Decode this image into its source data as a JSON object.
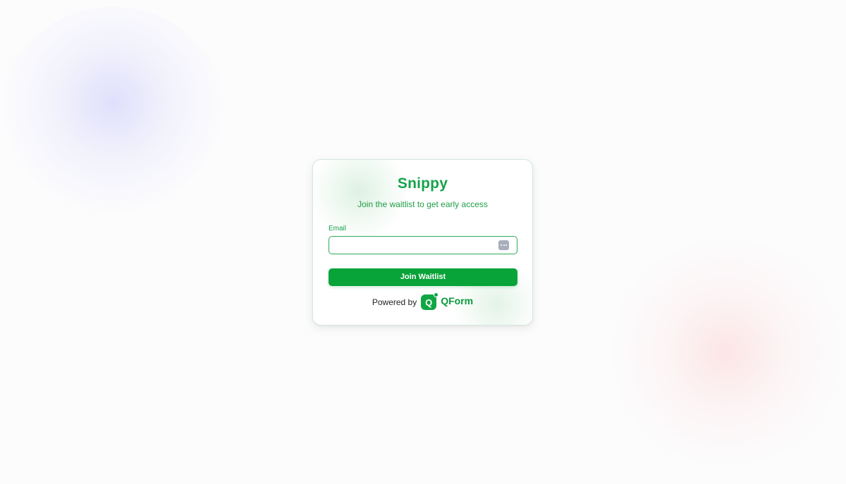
{
  "form": {
    "title": "Snippy",
    "subtitle": "Join the waitlist to get early access",
    "email_label": "Email",
    "email_value": "",
    "email_placeholder": "",
    "submit_label": "Join Waitlist"
  },
  "footer": {
    "powered_by": "Powered by",
    "logo_letter": "Q",
    "brand_name": "QForm"
  },
  "icons": {
    "password_manager": "password-manager-icon",
    "brand_logo": "qform-logo-icon"
  },
  "colors": {
    "accent": "#16a34a",
    "button": "#08a339",
    "background": "#fcfcfd",
    "blob_left": "#d6d6fc",
    "blob_right": "#fcdede"
  }
}
